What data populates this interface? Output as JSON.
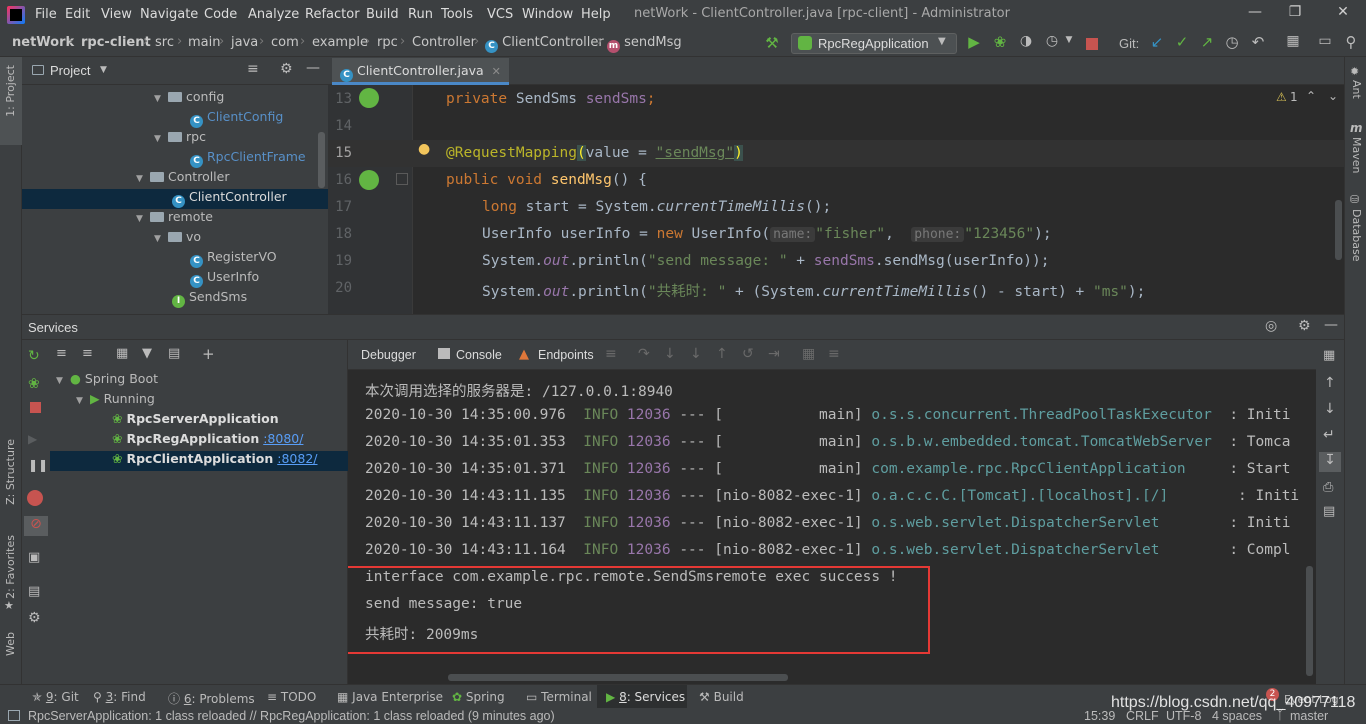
{
  "menu": [
    "File",
    "Edit",
    "View",
    "Navigate",
    "Code",
    "Analyze",
    "Refactor",
    "Build",
    "Run",
    "Tools",
    "VCS",
    "Window",
    "Help"
  ],
  "window_title": "netWork - ClientController.java [rpc-client] - Administrator",
  "breadcrumbs": [
    "netWork",
    "rpc-client",
    "src",
    "main",
    "java",
    "com",
    "example",
    "rpc",
    "Controller",
    "ClientController",
    "sendMsg"
  ],
  "run_config": "RpcRegApplication",
  "git_label": "Git:",
  "left_stripe": {
    "project": "1: Project",
    "structure": "Z: Structure",
    "favorites": "2: Favorites",
    "web": "Web"
  },
  "right_stripe": {
    "ant": "Ant",
    "maven": "Maven",
    "database": "Database"
  },
  "project_panel": {
    "title": "Project",
    "items": [
      {
        "label": "config",
        "kind": "folder"
      },
      {
        "label": "ClientConfig",
        "kind": "class"
      },
      {
        "label": "rpc",
        "kind": "folder"
      },
      {
        "label": "RpcClientFrame",
        "kind": "class"
      },
      {
        "label": "Controller",
        "kind": "folder"
      },
      {
        "label": "ClientController",
        "kind": "class"
      },
      {
        "label": "remote",
        "kind": "folder"
      },
      {
        "label": "vo",
        "kind": "folder"
      },
      {
        "label": "RegisterVO",
        "kind": "class"
      },
      {
        "label": "UserInfo",
        "kind": "class"
      },
      {
        "label": "SendSms",
        "kind": "interface"
      }
    ]
  },
  "editor": {
    "tab_label": "ClientController.java",
    "warning_count": "1",
    "line_numbers": [
      "13",
      "14",
      "15",
      "16",
      "17",
      "18",
      "19",
      "20"
    ],
    "code": {
      "l13_kw": "private ",
      "l13_type": "SendSms ",
      "l13_field": "sendSms",
      "l13_end": ";",
      "l15_ann": "@RequestMapping",
      "l15_paren_open": "(",
      "l15_mid": "value = ",
      "l15_str": "\"sendMsg\"",
      "l15_paren_close": ")",
      "l16_kw": "public void ",
      "l16_fn": "sendMsg",
      "l16_end": "() {",
      "l17_kw": "long ",
      "l17_mid": "start = System.",
      "l17_call": "currentTimeMillis",
      "l17_end": "();",
      "l18_a": "UserInfo userInfo = ",
      "l18_kw": "new ",
      "l18_b": "UserInfo(",
      "l18_hint1": "name:",
      "l18_str1": "\"fisher\"",
      "l18_c": ",  ",
      "l18_hint2": "phone:",
      "l18_str2": "\"123456\"",
      "l18_end": ");",
      "l19_a": "System.",
      "l19_out": "out",
      "l19_b": ".println(",
      "l19_str": "\"send message: \"",
      "l19_c": " + ",
      "l19_fld": "sendSms",
      "l19_d": ".sendMsg(userInfo));",
      "l20_a": "System.",
      "l20_out": "out",
      "l20_b": ".println(",
      "l20_str": "\"共耗时: \"",
      "l20_c": " + (System.",
      "l20_call": "currentTimeMillis",
      "l20_d": "() - start) + ",
      "l20_str2": "\"ms\"",
      "l20_end": ");"
    }
  },
  "services": {
    "title": "Services",
    "tree": {
      "root": "Spring Boot",
      "group": "Running",
      "apps": [
        {
          "name": "RpcServerApplication",
          "port": ""
        },
        {
          "name": "RpcRegApplication",
          "port": ":8080/"
        },
        {
          "name": "RpcClientApplication",
          "port": ":8082/"
        }
      ]
    },
    "console_tabs": [
      "Debugger",
      "Console",
      "Endpoints"
    ],
    "log_header": "本次调用选择的服务器是: /127.0.0.1:8940",
    "log_lines": [
      {
        "ts": "2020-10-30 14:35:00.976",
        "level": "INFO",
        "pid": "12036",
        "sep": "---",
        "thread": "[           main]",
        "logger": "o.s.s.concurrent.ThreadPoolTaskExecutor",
        "msg": ": Initi"
      },
      {
        "ts": "2020-10-30 14:35:01.353",
        "level": "INFO",
        "pid": "12036",
        "sep": "---",
        "thread": "[           main]",
        "logger": "o.s.b.w.embedded.tomcat.TomcatWebServer",
        "msg": ": Tomca"
      },
      {
        "ts": "2020-10-30 14:35:01.371",
        "level": "INFO",
        "pid": "12036",
        "sep": "---",
        "thread": "[           main]",
        "logger": "com.example.rpc.RpcClientApplication",
        "msg": ": Start"
      },
      {
        "ts": "2020-10-30 14:43:11.135",
        "level": "INFO",
        "pid": "12036",
        "sep": "---",
        "thread": "[nio-8082-exec-1]",
        "logger": "o.a.c.c.C.[Tomcat].[localhost].[/]",
        "msg": ": Initi"
      },
      {
        "ts": "2020-10-30 14:43:11.137",
        "level": "INFO",
        "pid": "12036",
        "sep": "---",
        "thread": "[nio-8082-exec-1]",
        "logger": "o.s.web.servlet.DispatcherServlet",
        "msg": ": Initi"
      },
      {
        "ts": "2020-10-30 14:43:11.164",
        "level": "INFO",
        "pid": "12036",
        "sep": "---",
        "thread": "[nio-8082-exec-1]",
        "logger": "o.s.web.servlet.DispatcherServlet",
        "msg": ": Compl"
      }
    ],
    "highlight_lines": [
      "interface com.example.rpc.remote.SendSmsremote exec success !",
      "send message: true",
      "共耗时: 2009ms"
    ]
  },
  "bottom_tabs": [
    {
      "num": "9",
      "label": ": Git"
    },
    {
      "num": "3",
      "label": ": Find"
    },
    {
      "num": "6",
      "label": ": Problems"
    },
    {
      "num": "",
      "label": "TODO"
    },
    {
      "num": "",
      "label": "Java Enterprise"
    },
    {
      "num": "",
      "label": "Spring"
    },
    {
      "num": "",
      "label": "Terminal"
    },
    {
      "num": "8",
      "label": ": Services"
    },
    {
      "num": "",
      "label": "Build"
    }
  ],
  "event_log": {
    "badge": "2",
    "label": "Event Log"
  },
  "watermark": "https://blog.csdn.net/qq_40977118",
  "status": {
    "message": "RpcServerApplication: 1 class reloaded // RpcRegApplication: 1 class reloaded (9 minutes ago)",
    "position": "15:39",
    "line_sep": "CRLF",
    "encoding": "UTF-8",
    "indent": "4 spaces",
    "branch": "master"
  },
  "colors": {
    "accent_blue": "#4a88c7",
    "highlight_border": "#e53935",
    "selection": "#0d293e"
  }
}
